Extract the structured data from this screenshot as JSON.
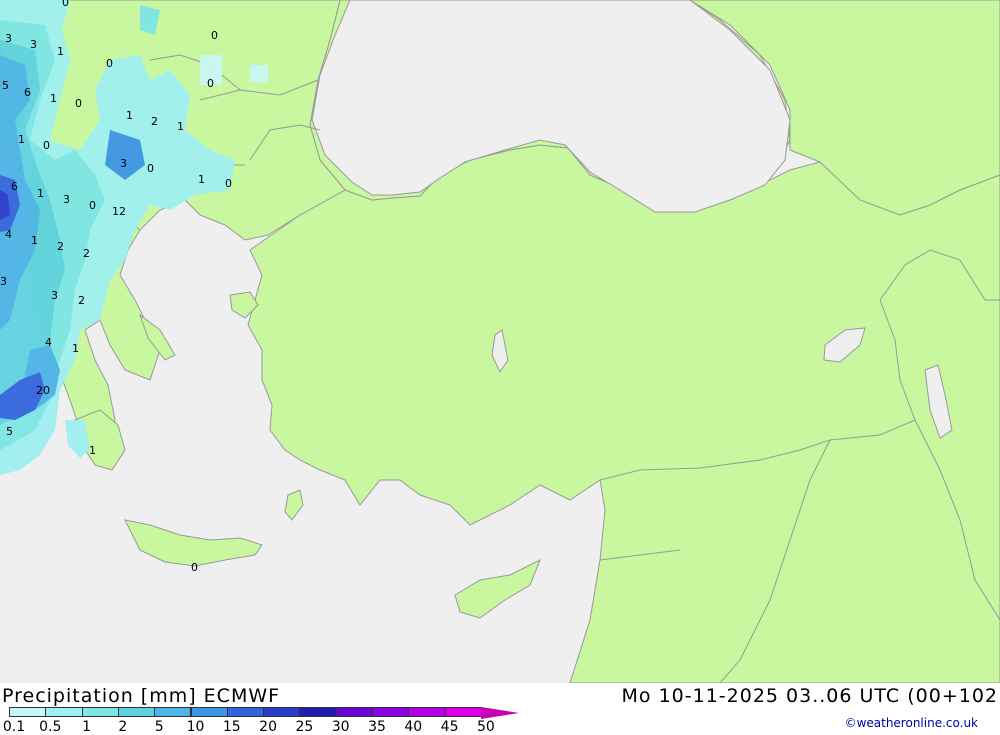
{
  "map": {
    "sea_color": "#efefef",
    "land_color": "#c8f7a0",
    "border_color": "#999999",
    "precip_amounts": [
      "0",
      "3",
      "3",
      "1",
      "0",
      "0",
      "0",
      "5",
      "6",
      "1",
      "0",
      "1",
      "2",
      "1",
      "1",
      "0",
      "3",
      "0",
      "1",
      "0",
      "6",
      "1",
      "3",
      "0",
      "12",
      "4",
      "1",
      "2",
      "2",
      "3",
      "3",
      "2",
      "4",
      "1",
      "20",
      "5",
      "1",
      "0"
    ]
  },
  "footer": {
    "title": "Precipitation [mm] ECMWF",
    "run_info": "Mo 10-11-2025 03..06 UTC (00+102",
    "credit": "©weatheronline.co.uk"
  },
  "legend": {
    "ticks": [
      "0.1",
      "0.5",
      "1",
      "2",
      "5",
      "10",
      "15",
      "20",
      "25",
      "30",
      "35",
      "40",
      "45",
      "50"
    ],
    "colors": [
      "#c8f7f7",
      "#9ff0f0",
      "#7ee6e6",
      "#5ed2e0",
      "#4cb4e6",
      "#3c96e6",
      "#3264dc",
      "#283cc8",
      "#1e1eb4",
      "#6a00d6",
      "#8c00e6",
      "#b400e6",
      "#e000e6",
      "#c800b4"
    ]
  }
}
